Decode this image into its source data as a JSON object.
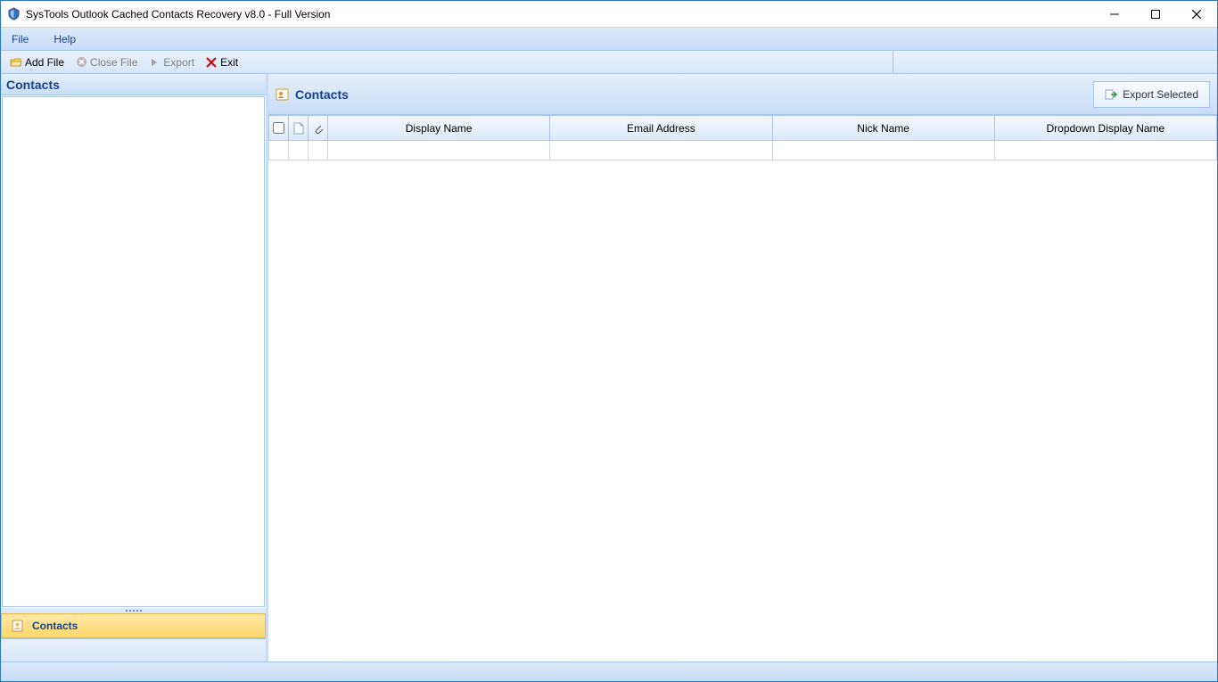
{
  "window": {
    "title": "SysTools Outlook Cached Contacts Recovery v8.0  - Full Version"
  },
  "menu": {
    "file": "File",
    "help": "Help"
  },
  "toolbar": {
    "add_file": "Add File",
    "close_file": "Close File",
    "export": "Export",
    "exit": "Exit"
  },
  "left": {
    "header": "Contacts",
    "nav_contacts": "Contacts"
  },
  "content": {
    "title": "Contacts",
    "export_selected": "Export Selected"
  },
  "grid": {
    "columns": {
      "display_name": "Display Name",
      "email": "Email Address",
      "nick": "Nick Name",
      "dropdown": "Dropdown Display Name"
    },
    "rows": []
  }
}
